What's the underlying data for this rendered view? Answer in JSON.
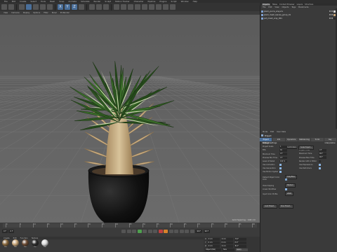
{
  "app": {
    "menu": [
      "File",
      "Edit",
      "Create",
      "Select",
      "Tools",
      "Mesh",
      "Snap",
      "Animate",
      "Simulate",
      "Render",
      "Sculpt",
      "Motion Tracker",
      "Character",
      "Pipeline",
      "Plugins",
      "Script",
      "Window",
      "Help"
    ]
  },
  "toolbar": {
    "icons": [
      "undo-icon",
      "redo-icon",
      "select-icon",
      "move-icon",
      "scale-icon",
      "rotate-icon",
      "recent-icon",
      "x-axis-icon",
      "y-axis-icon",
      "z-axis-icon",
      "world-icon",
      "render-view-icon",
      "render-picture-icon",
      "render-settings-icon",
      "cube-icon",
      "pen-icon",
      "subdivide-icon",
      "array-icon",
      "spline-icon",
      "deformer-icon",
      "floor-icon",
      "camera-icon",
      "light-icon"
    ],
    "axis_labels": [
      "X",
      "Y",
      "Z"
    ]
  },
  "viewport": {
    "menu": [
      "View",
      "Cameras",
      "Display",
      "Options",
      "Filter",
      "Panel",
      "ProRender"
    ],
    "grid_spacing": "Grid Spacing : 100 cm"
  },
  "timeline": {
    "ticks": [
      "0",
      "5",
      "10",
      "15",
      "20",
      "25",
      "30",
      "35",
      "40",
      "45",
      "50",
      "55",
      "60",
      "65",
      "70",
      "75",
      "80",
      "85",
      "90"
    ],
    "start_field": "0 F",
    "start_field2": "0 F",
    "end_field": "90 F",
    "end_field2": "90 F",
    "current_frame": "0 F"
  },
  "materials": {
    "menu": [
      "Create",
      "Edit",
      "Function",
      "Texture"
    ],
    "items": [
      {
        "name": "Mat",
        "color": "#8a6a3f"
      },
      {
        "name": "Mat",
        "color": "#c9a77a"
      },
      {
        "name": "Mat",
        "color": "#6a4a33"
      },
      {
        "name": "Mat",
        "color": "#2a2a2a"
      },
      {
        "name": "Mat",
        "color": "#d8d8d8"
      }
    ]
  },
  "coordinates": {
    "rows": [
      {
        "axis": "X",
        "pos": "0 cm",
        "size": "0 cm",
        "rot": "H 0°"
      },
      {
        "axis": "Y",
        "pos": "0 cm",
        "size": "0 cm",
        "rot": "P 0°"
      },
      {
        "axis": "Z",
        "pos": "0 cm",
        "size": "0 cm",
        "rot": "B 0°"
      }
    ],
    "mode": "Object (Rel)",
    "size_mode": "Size",
    "apply": "Apply"
  },
  "object_manager": {
    "tabs": [
      "Objects",
      "Takes",
      "Content Browser",
      "Layers",
      "Structure"
    ],
    "active_tab": "Objects",
    "menu": [
      "File",
      "Edit",
      "View",
      "Objects",
      "Tags",
      "Bookmarks"
    ],
    "objects": [
      {
        "name": "plant_yucca_vray.vrs",
        "tag_color": "#d8d8d8"
      },
      {
        "name": "plant_mesh_leaves_group_01",
        "tag_color": "#c9a77a"
      },
      {
        "name": "pot_mesh_vray_001",
        "tag_color": "#2a2a2a"
      }
    ]
  },
  "attribute_manager": {
    "menu": [
      "Mode",
      "Edit",
      "User Data"
    ],
    "title": "Project",
    "tabs": [
      "Project Settings",
      "Info",
      "Dynamics",
      "Referencing",
      "To Do",
      "Key Interpolation"
    ],
    "section": "Project Settings",
    "fields_left": [
      {
        "label": "Project Scale",
        "value": "1"
      },
      {
        "label": "FPS",
        "value": "30"
      },
      {
        "label": "Minimum Time",
        "value": "0 F"
      },
      {
        "label": "Preview Min Time",
        "value": "0 F"
      },
      {
        "label": "Level of Detail",
        "value": "100 %"
      },
      {
        "label": "Use Animation",
        "checked": true
      },
      {
        "label": "Use Generators",
        "checked": true
      },
      {
        "label": "Use Motion System",
        "checked": true
      }
    ],
    "fields_right": [
      {
        "label": "Project Time",
        "value": "0 F"
      },
      {
        "label": "Maximum Time",
        "value": "90 F"
      },
      {
        "label": "Preview Max Time",
        "value": "90 F"
      },
      {
        "label": "Render LOD in Editor",
        "checked": false
      },
      {
        "label": "Use Expressions",
        "checked": true
      },
      {
        "label": "Use Deformers",
        "checked": true
      }
    ],
    "scale_button": "Scale Project...",
    "scale_unit": "Centimeters",
    "default_object_color_label": "Default Object Color",
    "default_object_color": "Gray-Blue",
    "color_label": "Color",
    "view_clipping_label": "View Clipping",
    "view_clipping": "Medium",
    "linear_workflow_label": "Linear Workflow",
    "input_color_profile_label": "Input Color Profile",
    "input_color_profile": "sRGB",
    "load_preset": "Load Preset...",
    "save_preset": "Save Preset..."
  }
}
